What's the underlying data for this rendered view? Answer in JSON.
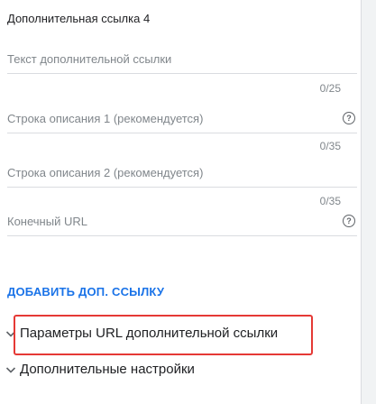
{
  "section": {
    "title": "Дополнительная ссылка 4"
  },
  "fields": {
    "link_text": {
      "label": "Текст дополнительной ссылки",
      "counter": "0/25"
    },
    "description1": {
      "label": "Строка описания 1 (рекомендуется)",
      "counter": "0/35",
      "help_icon": "help-circle-icon"
    },
    "description2": {
      "label": "Строка описания 2 (рекомендуется)",
      "counter": "0/35"
    },
    "final_url": {
      "label": "Конечный URL",
      "help_icon": "help-circle-icon"
    }
  },
  "actions": {
    "add_link": "ДОБАВИТЬ ДОП. ССЫЛКУ"
  },
  "collapsibles": {
    "url_params": {
      "label": "Параметры URL дополнительной ссылки",
      "icon": "chevron-down-icon"
    },
    "additional_settings": {
      "label": "Дополнительные настройки",
      "icon": "chevron-down-icon"
    }
  },
  "colors": {
    "accent": "#1a73e8",
    "highlight": "#e53935",
    "muted_text": "#80868b",
    "divider": "#dadce0"
  }
}
